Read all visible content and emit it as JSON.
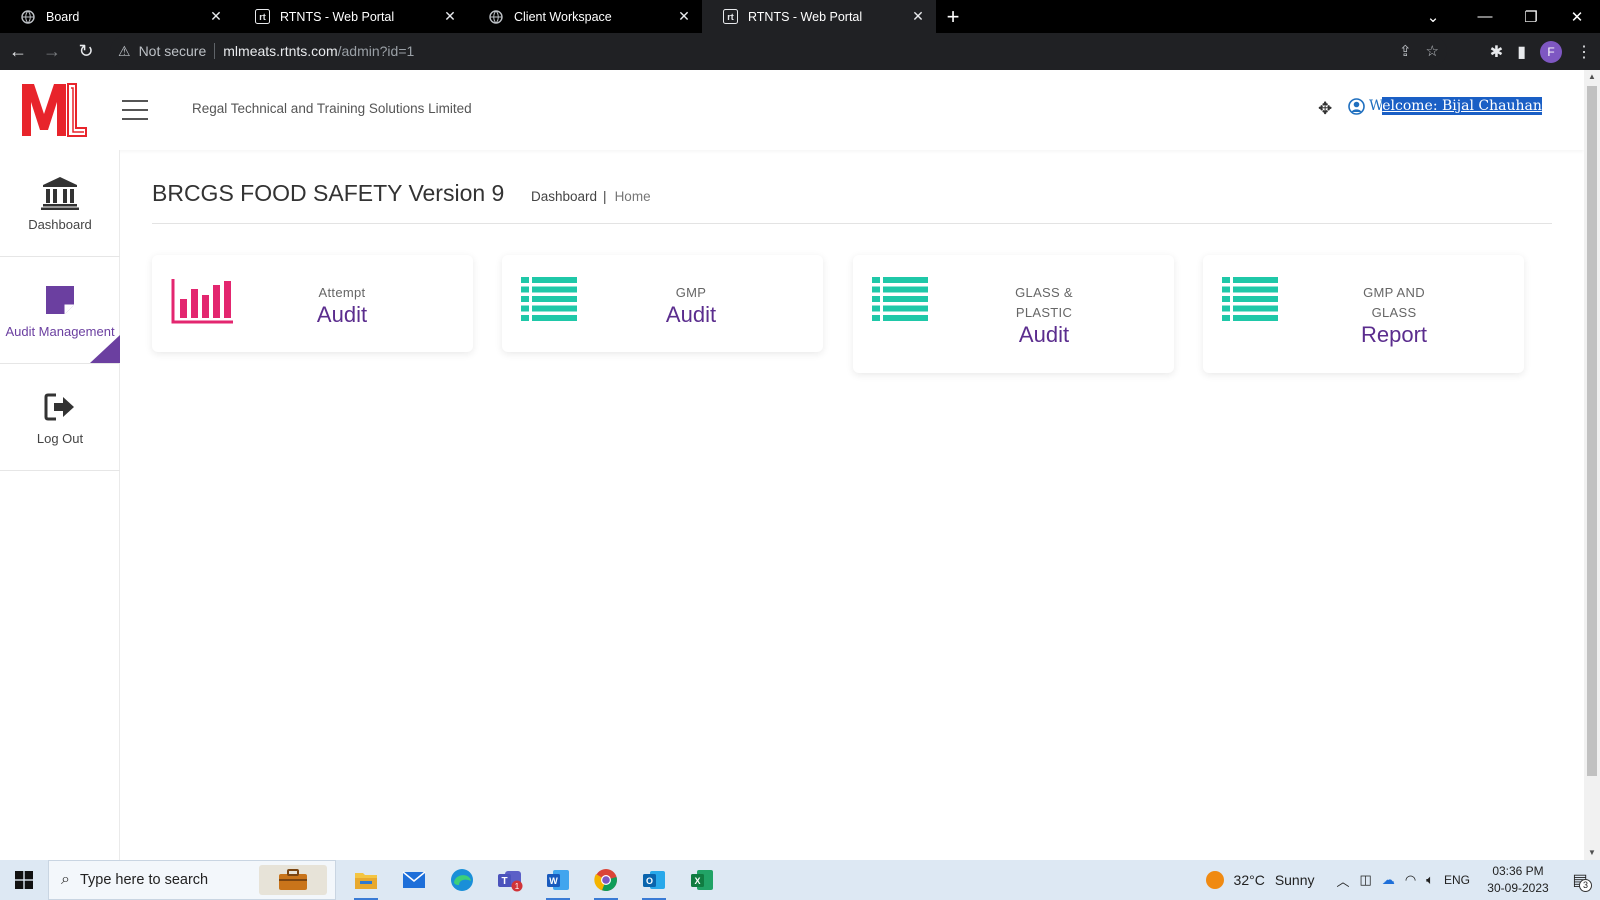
{
  "browser": {
    "tabs": [
      {
        "title": "Board",
        "favicon": "globe-icon",
        "active": false
      },
      {
        "title": "RTNTS - Web Portal",
        "favicon": "rt-favicon",
        "active": false
      },
      {
        "title": "Client Workspace",
        "favicon": "globe-icon",
        "active": false
      },
      {
        "title": "RTNTS - Web Portal",
        "favicon": "rt-favicon",
        "active": true
      }
    ],
    "security_label": "Not secure",
    "url_host": "mlmeats.rtnts.com",
    "url_path": "/admin?id=1",
    "profile_initial": "F"
  },
  "header": {
    "company_name": "Regal Technical and Training Solutions Limited",
    "welcome_prefix": "W",
    "welcome_rest": "elcome: Bijal Chauhan"
  },
  "sidebar": {
    "items": [
      {
        "label": "Dashboard",
        "icon": "bank-icon"
      },
      {
        "label": "Audit Management",
        "icon": "sticky-note-icon",
        "active": true
      },
      {
        "label": "Log Out",
        "icon": "sign-out-icon"
      }
    ]
  },
  "main": {
    "title": "BRCGS FOOD SAFETY Version 9",
    "breadcrumb": {
      "dashboard": "Dashboard",
      "separator": "|",
      "home": "Home"
    },
    "cards": [
      {
        "small": "Attempt",
        "big": "Audit",
        "icon": "bar-chart-icon",
        "icon_color": "#e3266f"
      },
      {
        "small": "GMP",
        "big": "Audit",
        "icon": "list-icon",
        "icon_color": "#1fc8a8"
      },
      {
        "small_line1": "GLASS &",
        "small_line2": "PLASTIC",
        "big": "Audit",
        "icon": "list-icon",
        "icon_color": "#1fc8a8"
      },
      {
        "small_line1": "GMP AND",
        "small_line2": "GLASS",
        "big": "Report",
        "icon": "list-icon",
        "icon_color": "#1fc8a8"
      }
    ]
  },
  "taskbar": {
    "search_placeholder": "Type here to search",
    "apps": [
      "file-explorer-icon",
      "mail-icon",
      "edge-icon",
      "teams-icon",
      "word-icon",
      "chrome-icon",
      "outlook-icon",
      "excel-icon"
    ],
    "teams_badge": "1",
    "weather_temp": "32°C",
    "weather_text": "Sunny",
    "language": "ENG",
    "time": "03:36 PM",
    "date": "30-09-2023",
    "notification_count": "3"
  },
  "colors": {
    "brand_purple": "#5b2d8e",
    "accent_teal": "#1fc8a8",
    "accent_pink": "#e3266f",
    "logo_red": "#e8242b"
  }
}
